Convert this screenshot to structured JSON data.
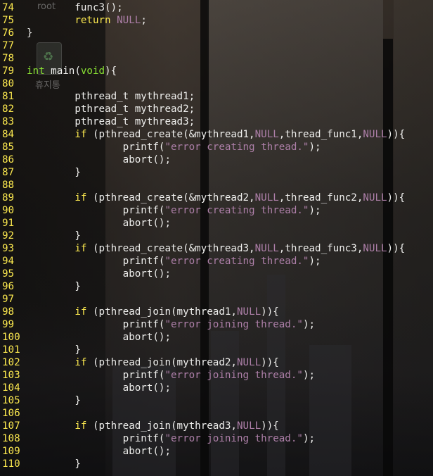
{
  "desktop": {
    "user_label": "root",
    "trash_label": "휴지통"
  },
  "editor": {
    "lines": [
      {
        "n": "74",
        "parts": [
          {
            "t": "        func3();",
            "c": ""
          }
        ]
      },
      {
        "n": "75",
        "parts": [
          {
            "t": "        ",
            "c": ""
          },
          {
            "t": "return",
            "c": "kw"
          },
          {
            "t": " ",
            "c": ""
          },
          {
            "t": "NULL",
            "c": "num"
          },
          {
            "t": ";",
            "c": ""
          }
        ]
      },
      {
        "n": "76",
        "parts": [
          {
            "t": "}",
            "c": ""
          }
        ]
      },
      {
        "n": "77",
        "parts": []
      },
      {
        "n": "78",
        "parts": []
      },
      {
        "n": "79",
        "parts": [
          {
            "t": "int",
            "c": "type"
          },
          {
            "t": " main(",
            "c": ""
          },
          {
            "t": "void",
            "c": "type"
          },
          {
            "t": "){",
            "c": ""
          }
        ]
      },
      {
        "n": "80",
        "parts": []
      },
      {
        "n": "81",
        "parts": [
          {
            "t": "        pthread_t mythread1;",
            "c": ""
          }
        ]
      },
      {
        "n": "82",
        "parts": [
          {
            "t": "        pthread_t mythread2;",
            "c": ""
          }
        ]
      },
      {
        "n": "83",
        "parts": [
          {
            "t": "        pthread_t mythread3;",
            "c": ""
          }
        ]
      },
      {
        "n": "84",
        "parts": [
          {
            "t": "        ",
            "c": ""
          },
          {
            "t": "if",
            "c": "kw"
          },
          {
            "t": " (pthread_create(&mythread1,",
            "c": ""
          },
          {
            "t": "NULL",
            "c": "num"
          },
          {
            "t": ",thread_func1,",
            "c": ""
          },
          {
            "t": "NULL",
            "c": "num"
          },
          {
            "t": ")){",
            "c": ""
          }
        ]
      },
      {
        "n": "85",
        "parts": [
          {
            "t": "                printf(",
            "c": ""
          },
          {
            "t": "\"error creating thread.\"",
            "c": "str"
          },
          {
            "t": ");",
            "c": ""
          }
        ]
      },
      {
        "n": "86",
        "parts": [
          {
            "t": "                abort();",
            "c": ""
          }
        ]
      },
      {
        "n": "87",
        "parts": [
          {
            "t": "        }",
            "c": ""
          }
        ]
      },
      {
        "n": "88",
        "parts": []
      },
      {
        "n": "89",
        "parts": [
          {
            "t": "        ",
            "c": ""
          },
          {
            "t": "if",
            "c": "kw"
          },
          {
            "t": " (pthread_create(&mythread2,",
            "c": ""
          },
          {
            "t": "NULL",
            "c": "num"
          },
          {
            "t": ",thread_func2,",
            "c": ""
          },
          {
            "t": "NULL",
            "c": "num"
          },
          {
            "t": ")){",
            "c": ""
          }
        ]
      },
      {
        "n": "90",
        "parts": [
          {
            "t": "                printf(",
            "c": ""
          },
          {
            "t": "\"error creating thread.\"",
            "c": "str"
          },
          {
            "t": ");",
            "c": ""
          }
        ]
      },
      {
        "n": "91",
        "parts": [
          {
            "t": "                abort();",
            "c": ""
          }
        ]
      },
      {
        "n": "92",
        "parts": [
          {
            "t": "        }",
            "c": ""
          }
        ]
      },
      {
        "n": "93",
        "parts": [
          {
            "t": "        ",
            "c": ""
          },
          {
            "t": "if",
            "c": "kw"
          },
          {
            "t": " (pthread_create(&mythread3,",
            "c": ""
          },
          {
            "t": "NULL",
            "c": "num"
          },
          {
            "t": ",thread_func3,",
            "c": ""
          },
          {
            "t": "NULL",
            "c": "num"
          },
          {
            "t": ")){",
            "c": ""
          }
        ]
      },
      {
        "n": "94",
        "parts": [
          {
            "t": "                printf(",
            "c": ""
          },
          {
            "t": "\"error creating thread.\"",
            "c": "str"
          },
          {
            "t": ");",
            "c": ""
          }
        ]
      },
      {
        "n": "95",
        "parts": [
          {
            "t": "                abort();",
            "c": ""
          }
        ]
      },
      {
        "n": "96",
        "parts": [
          {
            "t": "        }",
            "c": ""
          }
        ]
      },
      {
        "n": "97",
        "parts": []
      },
      {
        "n": "98",
        "parts": [
          {
            "t": "        ",
            "c": ""
          },
          {
            "t": "if",
            "c": "kw"
          },
          {
            "t": " (pthread_join(mythread1,",
            "c": ""
          },
          {
            "t": "NULL",
            "c": "num"
          },
          {
            "t": ")){",
            "c": ""
          }
        ]
      },
      {
        "n": "99",
        "parts": [
          {
            "t": "                printf(",
            "c": ""
          },
          {
            "t": "\"error joining thread.\"",
            "c": "str"
          },
          {
            "t": ");",
            "c": ""
          }
        ]
      },
      {
        "n": "100",
        "parts": [
          {
            "t": "                abort();",
            "c": ""
          }
        ]
      },
      {
        "n": "101",
        "parts": [
          {
            "t": "        }",
            "c": ""
          }
        ]
      },
      {
        "n": "102",
        "parts": [
          {
            "t": "        ",
            "c": ""
          },
          {
            "t": "if",
            "c": "kw"
          },
          {
            "t": " (pthread_join(mythread2,",
            "c": ""
          },
          {
            "t": "NULL",
            "c": "num"
          },
          {
            "t": ")){",
            "c": ""
          }
        ]
      },
      {
        "n": "103",
        "parts": [
          {
            "t": "                printf(",
            "c": ""
          },
          {
            "t": "\"error joining thread.\"",
            "c": "str"
          },
          {
            "t": ");",
            "c": ""
          }
        ]
      },
      {
        "n": "104",
        "parts": [
          {
            "t": "                abort();",
            "c": ""
          }
        ]
      },
      {
        "n": "105",
        "parts": [
          {
            "t": "        }",
            "c": ""
          }
        ]
      },
      {
        "n": "106",
        "parts": []
      },
      {
        "n": "107",
        "parts": [
          {
            "t": "        ",
            "c": ""
          },
          {
            "t": "if",
            "c": "kw"
          },
          {
            "t": " (pthread_join(mythread3,",
            "c": ""
          },
          {
            "t": "NULL",
            "c": "num"
          },
          {
            "t": ")){",
            "c": ""
          }
        ]
      },
      {
        "n": "108",
        "parts": [
          {
            "t": "                printf(",
            "c": ""
          },
          {
            "t": "\"error joining thread.\"",
            "c": "str"
          },
          {
            "t": ");",
            "c": ""
          }
        ]
      },
      {
        "n": "109",
        "parts": [
          {
            "t": "                abort();",
            "c": ""
          }
        ]
      },
      {
        "n": "110",
        "parts": [
          {
            "t": "        }",
            "c": ""
          }
        ]
      }
    ]
  },
  "colors": {
    "line_number": "#fce94f",
    "keyword": "#fce94f",
    "type": "#8ae234",
    "constant_and_string": "#ad7fa8",
    "default_text": "#eeeeec"
  }
}
